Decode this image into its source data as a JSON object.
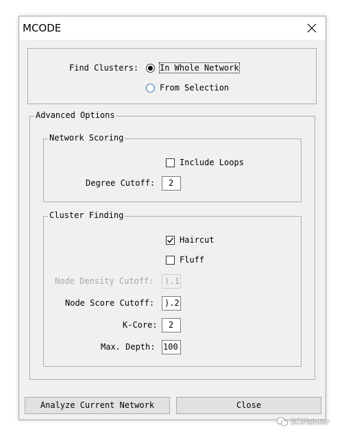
{
  "window": {
    "title": "MCODE",
    "close_icon": "close-icon"
  },
  "find_clusters": {
    "label": "Find Clusters:",
    "options": [
      {
        "label": "In Whole Network",
        "selected": true
      },
      {
        "label": "From Selection",
        "selected": false
      }
    ]
  },
  "advanced": {
    "legend": "Advanced Options",
    "network_scoring": {
      "legend": "Network Scoring",
      "include_loops_label": "Include Loops",
      "include_loops_checked": false,
      "degree_cutoff_label": "Degree Cutoff:",
      "degree_cutoff_value": "2"
    },
    "cluster_finding": {
      "legend": "Cluster Finding",
      "haircut_label": "Haircut",
      "haircut_checked": true,
      "fluff_label": "Fluff",
      "fluff_checked": false,
      "node_density_label": "Node Density Cutoff:",
      "node_density_value": ").1",
      "node_score_label": "Node Score Cutoff:",
      "node_score_value": ").2",
      "kcore_label": "K-Core:",
      "kcore_value": "2",
      "max_depth_label": "Max. Depth:",
      "max_depth_value": "100"
    }
  },
  "buttons": {
    "analyze": "Analyze Current Network",
    "close": "Close"
  },
  "watermark": {
    "text": "SCIPainter",
    "icon": "wechat-icon"
  }
}
